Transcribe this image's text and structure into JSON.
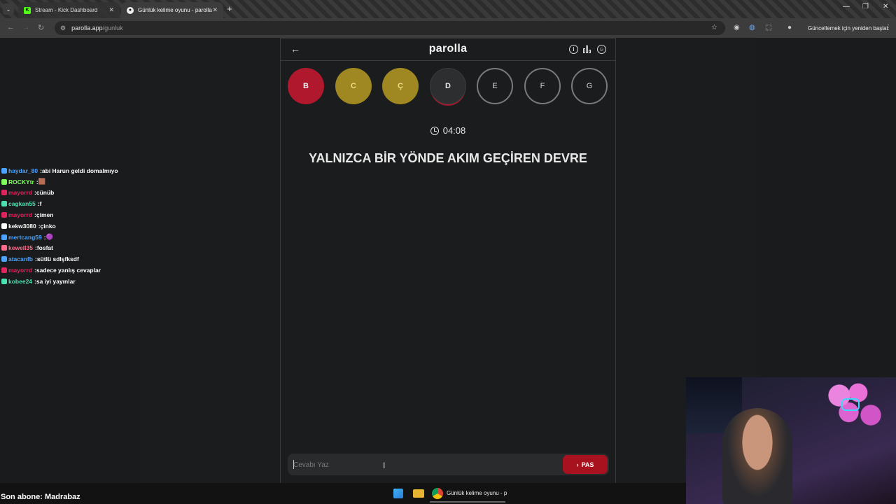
{
  "browser": {
    "tabs": [
      {
        "label": "Stream - Kick Dashboard",
        "favicon": "kick-icon",
        "active": false
      },
      {
        "label": "Günlük kelime oyunu - parolla",
        "favicon": "parolla-icon",
        "active": true
      }
    ],
    "url_host": "parolla.app",
    "url_path": "/gunluk",
    "update_button": "Güncellemek için yeniden başlat"
  },
  "game": {
    "title": "parolla",
    "letters": [
      {
        "letter": "B",
        "state": "wrong"
      },
      {
        "letter": "C",
        "state": "passed"
      },
      {
        "letter": "Ç",
        "state": "passed"
      },
      {
        "letter": "D",
        "state": "current"
      },
      {
        "letter": "E",
        "state": "pending"
      },
      {
        "letter": "F",
        "state": "pending"
      },
      {
        "letter": "G",
        "state": "pending"
      }
    ],
    "timer": "04:08",
    "question": "YALNIZCA BİR YÖNDE AKIM GEÇİREN DEVRE",
    "answer_placeholder": "Cevabı Yaz",
    "pass_label": "PAS"
  },
  "chat": [
    {
      "user": "haydar_80",
      "message": "abi Harun geldi domalmıyo",
      "color": "#4aa3ff"
    },
    {
      "user": "ROCKYtr",
      "message": "🟫",
      "color": "#7cff5a"
    },
    {
      "user": "mayorrd",
      "message": "cünüb",
      "color": "#e0245e"
    },
    {
      "user": "cagkan55",
      "message": "f",
      "color": "#4be0b0"
    },
    {
      "user": "mayorrd",
      "message": "çimen",
      "color": "#e0245e"
    },
    {
      "user": "kekw3080",
      "message": "çinko",
      "color": "#ffffff"
    },
    {
      "user": "mertcang59",
      "message": "🟣",
      "color": "#4aa3ff"
    },
    {
      "user": "kewell35",
      "message": "fosfat",
      "color": "#ff6b8b"
    },
    {
      "user": "atacanfb",
      "message": "sütlü sdlşfksdf",
      "color": "#4aa3ff"
    },
    {
      "user": "mayorrd",
      "message": "sadece yanlış cevaplar",
      "color": "#e0245e"
    },
    {
      "user": "kobee24",
      "message": "sa iyi yayınlar",
      "color": "#4be0b0"
    }
  ],
  "overlay": {
    "last_subscriber": "Son abone: Madrabaz"
  },
  "taskbar": {
    "chrome_label": "Günlük kelime oyunu - p"
  },
  "colors": {
    "wrong": "#b0182e",
    "passed": "#9f8722",
    "accent": "#a8121f"
  }
}
